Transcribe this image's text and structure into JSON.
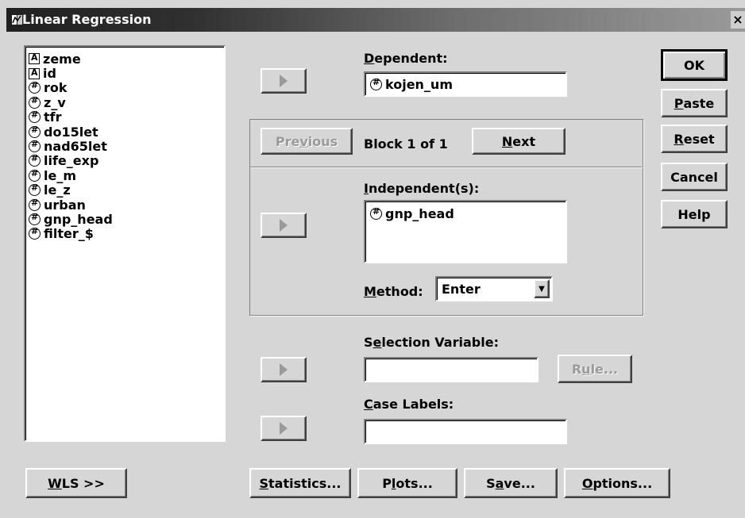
{
  "window": {
    "title": "Linear Regression",
    "close_label": "×"
  },
  "variables": [
    {
      "name": "zeme",
      "type": "string"
    },
    {
      "name": "id",
      "type": "string"
    },
    {
      "name": "rok",
      "type": "numeric"
    },
    {
      "name": "z_v",
      "type": "numeric"
    },
    {
      "name": "tfr",
      "type": "numeric"
    },
    {
      "name": "do15let",
      "type": "numeric"
    },
    {
      "name": "nad65let",
      "type": "numeric"
    },
    {
      "name": "life_exp",
      "type": "numeric"
    },
    {
      "name": "le_m",
      "type": "numeric"
    },
    {
      "name": "le_z",
      "type": "numeric"
    },
    {
      "name": "urban",
      "type": "numeric"
    },
    {
      "name": "gnp_head",
      "type": "numeric"
    },
    {
      "name": "filter_$",
      "type": "numeric"
    }
  ],
  "dependent": {
    "label_u": "D",
    "label_rest": "ependent:",
    "value": "kojen_um"
  },
  "block": {
    "previous_pre": "Pre",
    "previous_u": "v",
    "previous_post": "ious",
    "text": "Block 1 of 1",
    "next_u": "N",
    "next_rest": "ext"
  },
  "independents": {
    "label_u": "I",
    "label_rest": "ndependent(s):",
    "items": [
      "gnp_head"
    ]
  },
  "method": {
    "label_u": "M",
    "label_rest": "ethod:",
    "value": "Enter"
  },
  "selection": {
    "label_pre": "S",
    "label_u": "e",
    "label_rest": "lection Variable:",
    "value": "",
    "rule_pre": "R",
    "rule_u": "u",
    "rule_post": "le..."
  },
  "case_labels": {
    "label_u": "C",
    "label_rest": "ase Labels:",
    "value": ""
  },
  "side_buttons": {
    "ok": "OK",
    "paste_u": "P",
    "paste_rest": "aste",
    "reset_u": "R",
    "reset_rest": "eset",
    "cancel": "Cancel",
    "help": "Help"
  },
  "bottom_buttons": {
    "wls_u": "W",
    "wls_rest": "LS >>",
    "stats_u": "S",
    "stats_rest": "tatistics...",
    "plots_pre": "P",
    "plots_u": "l",
    "plots_rest": "ots...",
    "save_pre": "S",
    "save_u": "a",
    "save_rest": "ve...",
    "options_u": "O",
    "options_rest": "ptions..."
  }
}
